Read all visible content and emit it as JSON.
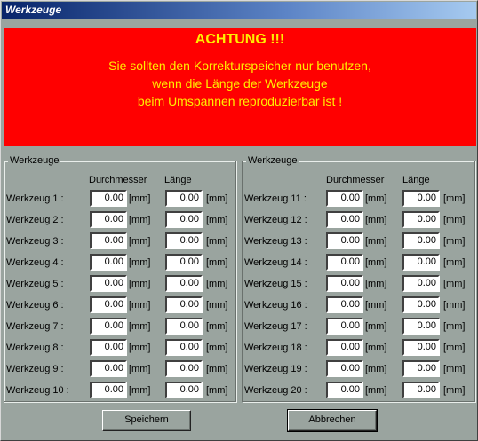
{
  "window": {
    "title": "Werkzeuge"
  },
  "warning": {
    "heading": "ACHTUNG !!!",
    "lines": [
      "Sie sollten den Korrekturspeicher nur benutzen,",
      "wenn die Länge der Werkzeuge",
      "beim Umspannen reproduzierbar ist !"
    ],
    "background": "#ff0000",
    "text_color": "#ffee00"
  },
  "groups": [
    {
      "label": "Werkzeuge",
      "col_diameter": "Durchmesser",
      "col_length": "Länge",
      "unit": "[mm]",
      "tools": [
        {
          "name": "Werkzeug 1 :",
          "diameter": "0.00",
          "length": "0.00"
        },
        {
          "name": "Werkzeug 2 :",
          "diameter": "0.00",
          "length": "0.00"
        },
        {
          "name": "Werkzeug 3 :",
          "diameter": "0.00",
          "length": "0.00"
        },
        {
          "name": "Werkzeug 4 :",
          "diameter": "0.00",
          "length": "0.00"
        },
        {
          "name": "Werkzeug 5 :",
          "diameter": "0.00",
          "length": "0.00"
        },
        {
          "name": "Werkzeug 6 :",
          "diameter": "0.00",
          "length": "0.00"
        },
        {
          "name": "Werkzeug 7 :",
          "diameter": "0.00",
          "length": "0.00"
        },
        {
          "name": "Werkzeug 8 :",
          "diameter": "0.00",
          "length": "0.00"
        },
        {
          "name": "Werkzeug 9 :",
          "diameter": "0.00",
          "length": "0.00"
        },
        {
          "name": "Werkzeug 10 :",
          "diameter": "0.00",
          "length": "0.00"
        }
      ]
    },
    {
      "label": "Werkzeuge",
      "col_diameter": "Durchmesser",
      "col_length": "Länge",
      "unit": "[mm]",
      "tools": [
        {
          "name": "Werkzeug 11 :",
          "diameter": "0.00",
          "length": "0.00"
        },
        {
          "name": "Werkzeug 12 :",
          "diameter": "0.00",
          "length": "0.00"
        },
        {
          "name": "Werkzeug 13 :",
          "diameter": "0.00",
          "length": "0.00"
        },
        {
          "name": "Werkzeug 14 :",
          "diameter": "0.00",
          "length": "0.00"
        },
        {
          "name": "Werkzeug 15 :",
          "diameter": "0.00",
          "length": "0.00"
        },
        {
          "name": "Werkzeug 16 :",
          "diameter": "0.00",
          "length": "0.00"
        },
        {
          "name": "Werkzeug 17 :",
          "diameter": "0.00",
          "length": "0.00"
        },
        {
          "name": "Werkzeug 18 :",
          "diameter": "0.00",
          "length": "0.00"
        },
        {
          "name": "Werkzeug 19 :",
          "diameter": "0.00",
          "length": "0.00"
        },
        {
          "name": "Werkzeug 20 :",
          "diameter": "0.00",
          "length": "0.00"
        }
      ]
    }
  ],
  "buttons": {
    "save": "Speichern",
    "cancel": "Abbrechen"
  }
}
